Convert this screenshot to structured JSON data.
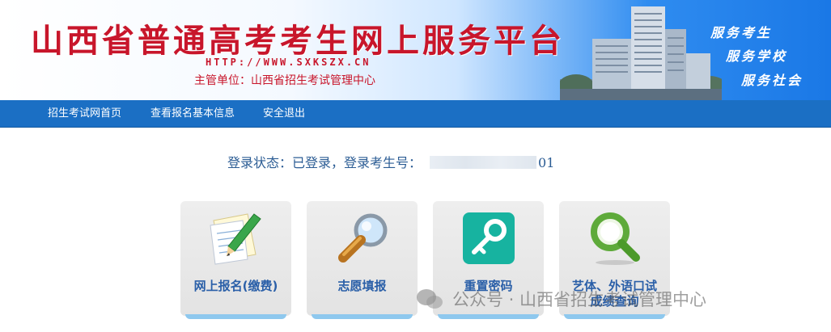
{
  "header": {
    "title": "山西省普通高考考生网上服务平台",
    "url": "HTTP://WWW.SXKSZX.CN",
    "organization": "主管单位：山西省招生考试管理中心",
    "slogans": [
      "服务考生",
      "服务学校",
      "服务社会"
    ]
  },
  "nav": {
    "items": [
      "招生考试网首页",
      "查看报名基本信息",
      "安全退出"
    ]
  },
  "status": {
    "prefix": "登录状态：已登录，登录考生号：",
    "candidate_suffix": "01"
  },
  "cards": [
    {
      "label": "网上报名(缴费)",
      "icon": "pencil-paper-icon"
    },
    {
      "label": "志愿填报",
      "icon": "magnifier-icon"
    },
    {
      "label": "重置密码",
      "icon": "key-icon"
    },
    {
      "label": "艺体、外语口试成绩查询",
      "line1": "艺体、外语口试",
      "line2": "成绩查询",
      "icon": "green-magnifier-icon"
    }
  ],
  "watermark": {
    "text": "公众号 · 山西省招生考试管理中心"
  },
  "colors": {
    "title_red": "#c8162b",
    "nav_blue": "#1b6fc4",
    "label_blue": "#2a5fa8",
    "status_blue": "#2b5c94"
  }
}
